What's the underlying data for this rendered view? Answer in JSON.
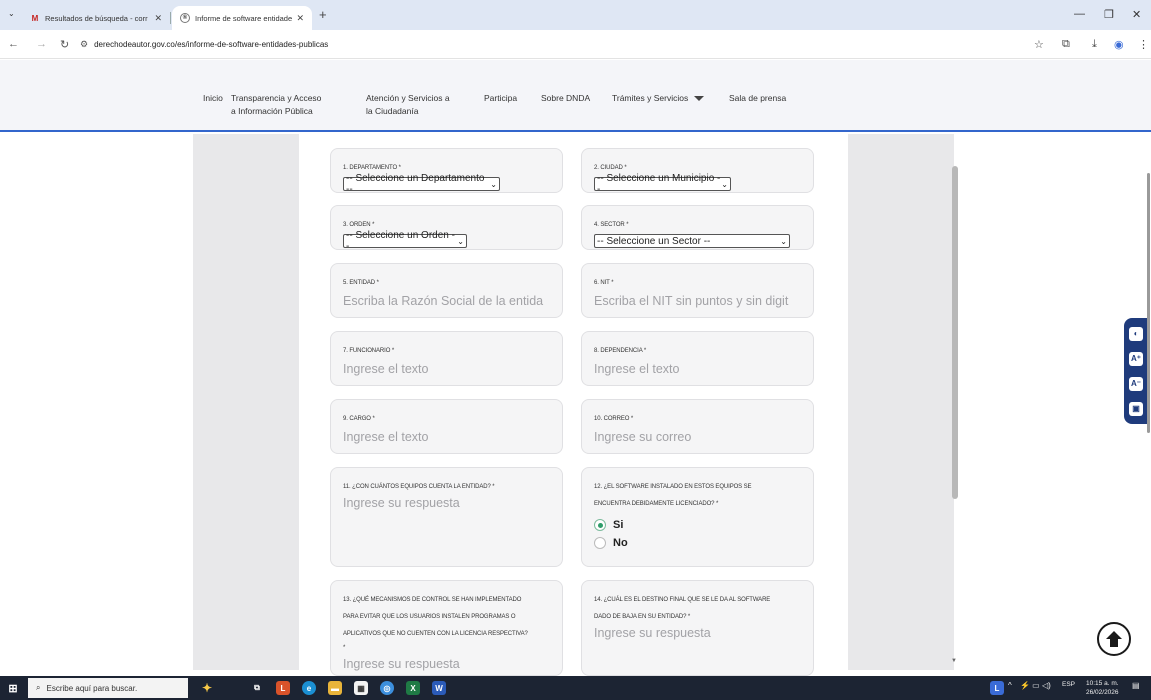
{
  "browser": {
    "tabs": [
      {
        "title": "Resultados de búsqueda - corr",
        "favicon": "gmail-icon",
        "active": false
      },
      {
        "title": "Informe de software entidade",
        "favicon": "site-icon",
        "active": true
      }
    ],
    "new_tab": "+",
    "url": "derechodeautor.gov.co/es/informe-de-software-entidades-publicas"
  },
  "nav": {
    "items": [
      {
        "label": "Inicio"
      },
      {
        "label": "Transparencia y Acceso",
        "label2": "a Información Pública"
      },
      {
        "label": "Atención y Servicios a",
        "label2": "la Ciudadanía"
      },
      {
        "label": "Participa"
      },
      {
        "label": "Sobre DNDA"
      },
      {
        "label": "Trámites y Servicios"
      },
      {
        "label": "Sala de prensa"
      }
    ]
  },
  "form": {
    "departamento": {
      "label": "1. DEPARTAMENTO *",
      "value": "-- Seleccione un Departamento --"
    },
    "ciudad": {
      "label": "2. CIUDAD *",
      "value": "-- Seleccione un Municipio --"
    },
    "orden": {
      "label": "3. ORDEN *",
      "value": "-- Seleccione un Orden --"
    },
    "sector": {
      "label": "4. SECTOR *",
      "value": "-- Seleccione un Sector --"
    },
    "entidad": {
      "label": "5. ENTIDAD *",
      "placeholder": "Escriba la Razón Social de la entida"
    },
    "nit": {
      "label": "6. NIT *",
      "placeholder": "Escriba el NIT sin puntos y sin digit"
    },
    "funcionario": {
      "label": "7. FUNCIONARIO *",
      "placeholder": "Ingrese el texto"
    },
    "dependencia": {
      "label": "8. DEPENDENCIA *",
      "placeholder": "Ingrese el texto"
    },
    "cargo": {
      "label": "9. CARGO *",
      "placeholder": "Ingrese el texto"
    },
    "correo": {
      "label": "10. CORREO *",
      "placeholder": "Ingrese su correo"
    },
    "equipos": {
      "label": "11. ¿CON CUÁNTOS EQUIPOS CUENTA LA ENTIDAD? *",
      "placeholder": "Ingrese su respuesta"
    },
    "licenciado": {
      "label1": "12. ¿EL SOFTWARE INSTALADO EN ESTOS EQUIPOS SE",
      "label2": "ENCUENTRA DEBIDAMENTE LICENCIADO? *",
      "option_yes": "Si",
      "option_no": "No",
      "selected": "Si"
    },
    "mecanismos": {
      "label1": "13. ¿QUÉ MECANISMOS DE CONTROL SE HAN IMPLEMENTADO",
      "label2": "PARA EVITAR QUE LOS USUARIOS INSTALEN PROGRAMAS O",
      "label3": "APLICATIVOS QUE NO CUENTEN CON LA LICENCIA RESPECTIVA?",
      "label4": "*",
      "placeholder": "Ingrese su respuesta"
    },
    "destino": {
      "label1": "14. ¿CUÁL ES EL DESTINO FINAL QUE SE LE DA AL SOFTWARE",
      "label2": "DADO DE BAJA EN SU ENTIDAD? *",
      "placeholder": "Ingrese su respuesta"
    }
  },
  "taskbar": {
    "search_placeholder": "Escribe aquí para buscar.",
    "language": "ESP",
    "time": "10:15 a. m.",
    "date": "26/02/2026"
  },
  "colors": {
    "accent": "#3366cc",
    "a11y_bar": "#1f3b7c",
    "radio_selected": "#2e9d6a",
    "taskbar": "#1c2433"
  }
}
